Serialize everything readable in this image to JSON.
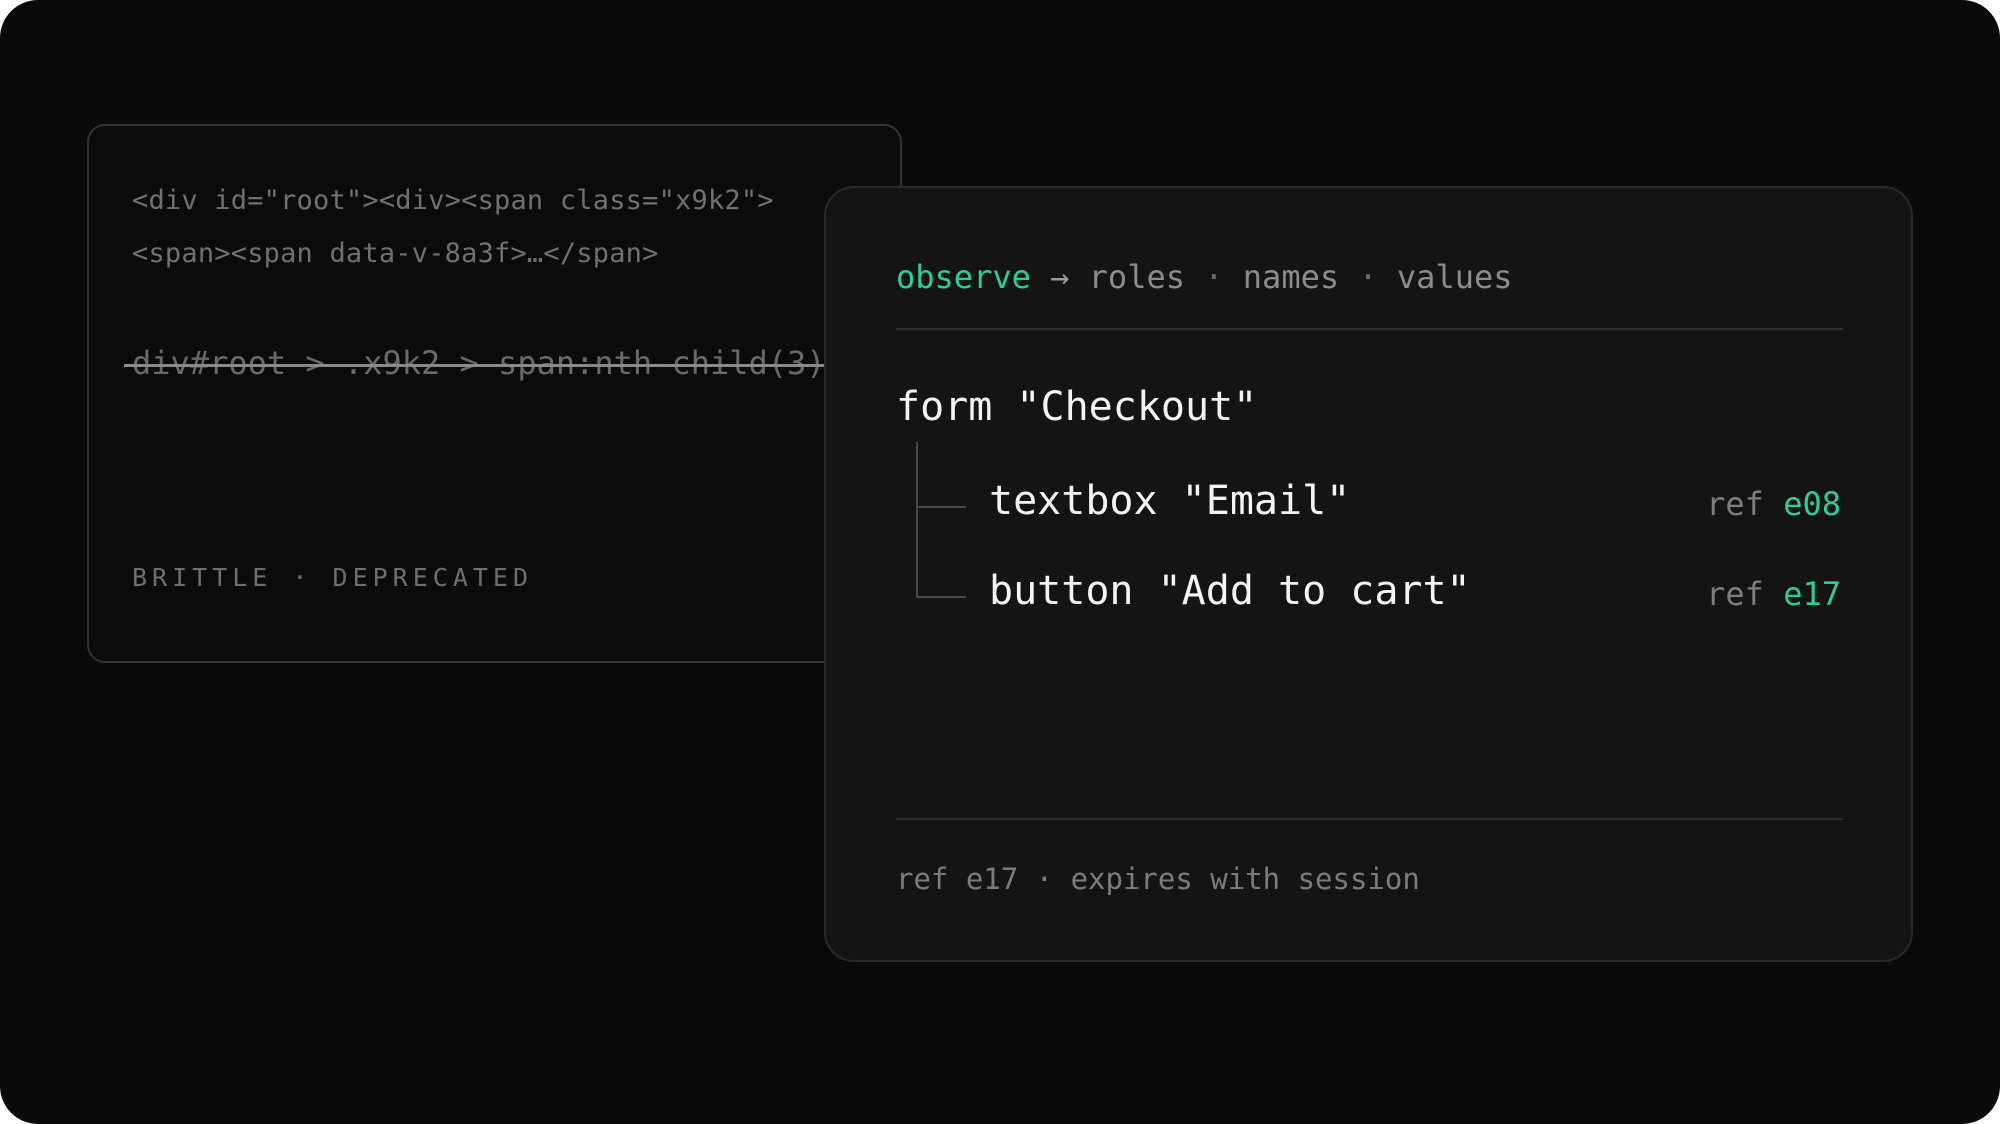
{
  "deprecated_card": {
    "html_line_1": "<div id=\"root\"><div><span class=\"x9k2\">",
    "html_line_2": "<span><span data-v-8a3f>…</span>",
    "selector": "div#root > .x9k2 > span:nth-child(3)",
    "footer": "BRITTLE · DEPRECATED"
  },
  "observe_card": {
    "header": {
      "keyword": "observe",
      "arrow": "→",
      "items": [
        "roles",
        "names",
        "values"
      ],
      "separator": "·"
    },
    "tree": {
      "root": "form \"Checkout\"",
      "children": [
        {
          "label": "textbox \"Email\"",
          "ref_prefix": "ref",
          "ref_id": "e08"
        },
        {
          "label": "button \"Add to cart\"",
          "ref_prefix": "ref",
          "ref_id": "e17"
        }
      ]
    },
    "footer": "ref e17 · expires with session"
  },
  "colors": {
    "background": "#0a0a0a",
    "accent": "#2ecc9a",
    "card_surface": "#141414"
  }
}
